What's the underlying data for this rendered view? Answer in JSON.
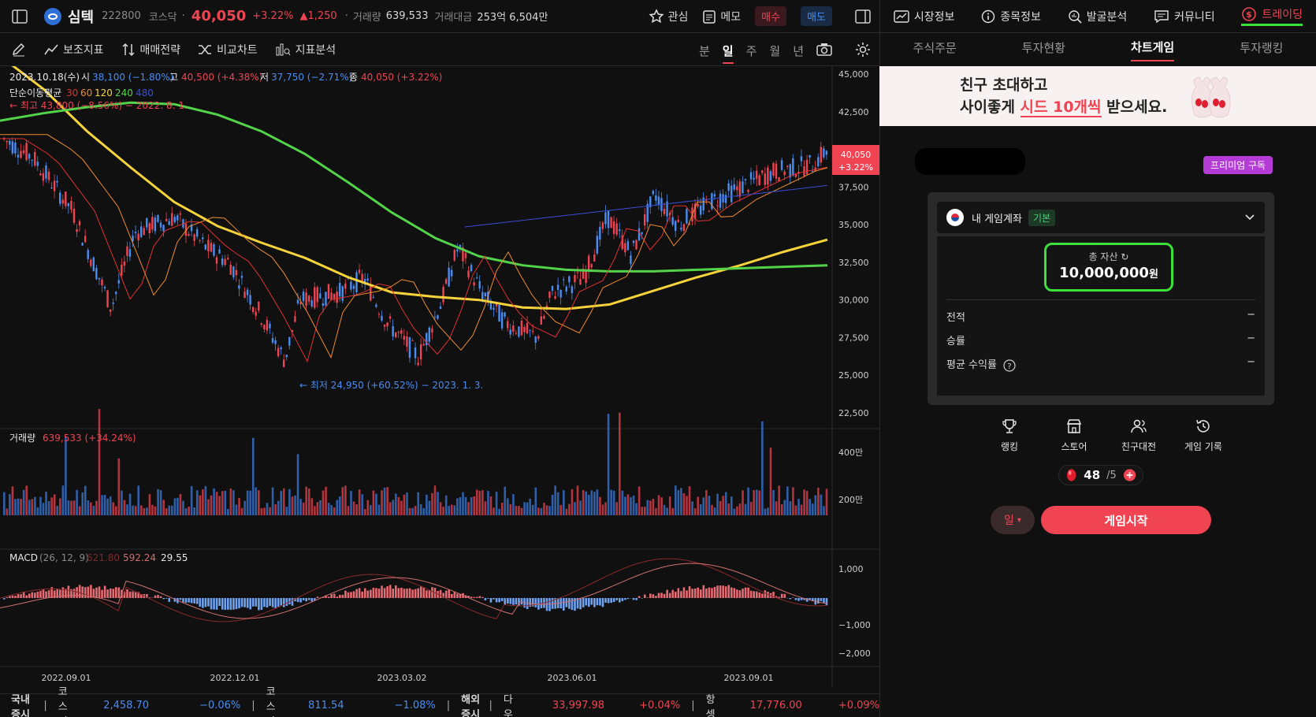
{
  "header": {
    "stock_name": "심텍",
    "code": "222800",
    "market": "코스닥",
    "price": "40,050",
    "change_pct": "+3.22%",
    "change_amt": "▲1,250",
    "volume_label": "거래량",
    "volume": "639,533",
    "amount_label": "거래대금",
    "amount": "253억 6,504만",
    "watch_label": "관심",
    "memo_label": "메모",
    "buy_label": "매수",
    "sell_label": "매도"
  },
  "toolbar": {
    "indicator": "보조지표",
    "strategy": "매매전략",
    "compare": "비교차트",
    "analysis": "지표분석",
    "periods": [
      "분",
      "일",
      "주",
      "월",
      "년"
    ],
    "active_period": "일"
  },
  "chart": {
    "ohlc_date": "2023.10.18(수)",
    "open_label": "시",
    "open": "38,100 (−1.80%)",
    "high_label": "고",
    "high": "40,500 (+4.38%)",
    "low_label": "저",
    "low": "37,750 (−2.71%)",
    "close_label": "종",
    "close": "40,050 (+3.22%)",
    "ma_label": "단순이동평균",
    "ma_periods": [
      "30",
      "60",
      "120",
      "240",
      "480"
    ],
    "max_note": "← 최고 43,800 (−8.56%) − 2022. 8. 1.",
    "min_note": "← 최저 24,950 (+60.52%) − 2023. 1. 3.",
    "price_tag": "40,050",
    "price_tag_pct": "+3.22%",
    "volume_title": "거래량",
    "volume_value": "639,533 (+34.24%)",
    "macd_title": "MACD",
    "macd_params": "(26, 12, 9)",
    "macd_v1": "621.80",
    "macd_v2": "592.24",
    "macd_v3": "29.55"
  },
  "chart_data": [
    {
      "type": "line",
      "title": "",
      "y_ticks": [
        "45,000",
        "42,500",
        "40,000",
        "37,500",
        "35,000",
        "32,500",
        "30,000",
        "27,500",
        "25,000",
        "22,500"
      ],
      "x_ticks": [
        "2022.09.01",
        "2022.12.01",
        "2023.03.02",
        "2023.06.01",
        "2023.09.01"
      ],
      "ylim": [
        22500,
        45000
      ],
      "series": [
        {
          "name": "",
          "color": "#f6d33b",
          "values": [
            46200,
            44000,
            41200,
            38800,
            36500,
            34900,
            33800,
            32800,
            31500,
            30500,
            30200,
            30000,
            29500,
            29400,
            29700,
            30600,
            31500,
            32300,
            33200,
            34000
          ]
        },
        {
          "name": "",
          "color": "#52d34a",
          "values": [
            41900,
            42400,
            42800,
            43100,
            43000,
            42300,
            41200,
            39700,
            37800,
            35800,
            34100,
            32900,
            32300,
            32000,
            31900,
            31900,
            32000,
            32100,
            32200,
            32300
          ]
        }
      ]
    },
    {
      "type": "bar",
      "title": "",
      "y_ticks": [
        "400만",
        "200만"
      ]
    },
    {
      "type": "bar",
      "title": "",
      "y_ticks": [
        "1,000",
        "−1,000",
        "−2,000"
      ]
    }
  ],
  "ticker": {
    "domestic": "국내 증시",
    "kospi_label": "코스피",
    "kospi": "2,458.70",
    "kospi_chg": "−0.06%",
    "kosdaq_label": "코스닥",
    "kosdaq": "811.54",
    "kosdaq_chg": "−1.08%",
    "overseas": "해외 증시",
    "dow_label": "다우",
    "dow": "33,997.98",
    "dow_chg": "+0.04%",
    "hs_label": "항셍",
    "hs": "17,776.00",
    "hs_chg": "+0.09%"
  },
  "right_nav": [
    "시장정보",
    "종목정보",
    "발굴분석",
    "커뮤니티",
    "트레이딩"
  ],
  "right_tabs": [
    "주식주문",
    "투자현황",
    "차트게임",
    "투자랭킹"
  ],
  "banner": {
    "line1": "친구 초대하고",
    "line2a": "사이좋게 ",
    "line2b": "시드 10개씩",
    "line2c": " 받으세요."
  },
  "game": {
    "premium": "프리미엄 구독",
    "account": "내 게임계좌",
    "account_tag": "기본",
    "asset_label": "총 자산",
    "asset_value": "10,000,000",
    "asset_unit": "원",
    "record_label": "전적",
    "record_value": "−",
    "winrate_label": "승률",
    "winrate_value": "−",
    "avg_label": "평균 수익률",
    "avg_value": "−",
    "menu": [
      "랭킹",
      "스토어",
      "친구대전",
      "게임 기록"
    ],
    "seed_count": "48",
    "seed_max": "/5",
    "day_label": "일",
    "start_label": "게임시작"
  },
  "colors": {
    "up": "#f04452",
    "down": "#4a8df0",
    "ma30": "#e03131",
    "ma60": "#f08c2e",
    "ma120": "#f6d33b",
    "ma240": "#52d34a",
    "ma480": "#3b4fd6"
  }
}
